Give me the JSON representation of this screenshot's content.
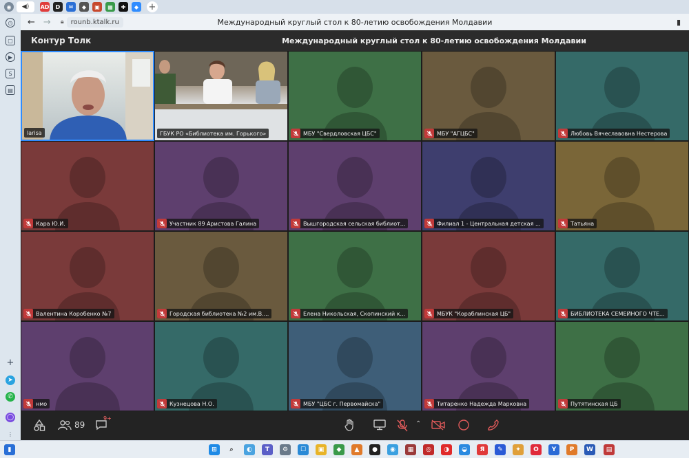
{
  "browser": {
    "url": "rounb.ktalk.ru",
    "page_title": "Международный круглый стол к 80-летию освобождения Молдавии",
    "tab_new_label": "+",
    "favicons": [
      {
        "name": "tab-favicon-ad",
        "glyph": "AD",
        "color": "#e03c3c"
      },
      {
        "name": "tab-favicon-d",
        "glyph": "D",
        "color": "#222222"
      },
      {
        "name": "tab-favicon-mail",
        "glyph": "✉",
        "color": "#2a6fd6"
      },
      {
        "name": "tab-favicon-cube",
        "glyph": "◆",
        "color": "#555555"
      },
      {
        "name": "tab-favicon-box",
        "glyph": "▣",
        "color": "#c7492e"
      },
      {
        "name": "tab-favicon-grid",
        "glyph": "▦",
        "color": "#3a9a4a"
      },
      {
        "name": "tab-favicon-plus",
        "glyph": "✚",
        "color": "#111111"
      },
      {
        "name": "tab-favicon-diamond",
        "glyph": "◆",
        "color": "#2f8cff"
      }
    ]
  },
  "app": {
    "brand": "Контур Толк",
    "meeting_title": "Международный круглый стол к 80-летию освобождения Молдавии"
  },
  "participants": [
    {
      "label": "larisa",
      "color": "#8fa0a6",
      "scene": "larisa",
      "muted": false,
      "active": true
    },
    {
      "label": "ГБУК РО «Библиотека им. Горького»",
      "color": "#a5a8a8",
      "scene": "gorky",
      "muted": false,
      "active": false
    },
    {
      "label": "МБУ \"Свердловская ЦБС\"",
      "color": "#3e7046",
      "muted": true
    },
    {
      "label": "МБУ \"АГЦБС\"",
      "color": "#6a5a3e",
      "muted": true
    },
    {
      "label": "Любовь Вячеславовна Нестерова",
      "color": "#356a68",
      "muted": true
    },
    {
      "label": "Кара Ю.И.",
      "color": "#7a3a3a",
      "muted": true
    },
    {
      "label": "Участник 89 Аристова Галина",
      "color": "#5e3f6e",
      "muted": true
    },
    {
      "label": "Вышгородская сельская библиот...",
      "color": "#5e3f6e",
      "muted": true
    },
    {
      "label": "Филиал 1 - Центральная детская ...",
      "color": "#3e3e6e",
      "muted": true
    },
    {
      "label": "Татьяна",
      "color": "#7a6638",
      "muted": true
    },
    {
      "label": "Валентина Коробенко №7",
      "color": "#7a3a3a",
      "muted": true
    },
    {
      "label": "Городская библиотека №2 им.В....",
      "color": "#6a5a3e",
      "muted": true
    },
    {
      "label": "Елена Никольская, Скопинский к...",
      "color": "#3e7046",
      "muted": true
    },
    {
      "label": "МБУК \"Кораблинская ЦБ\"",
      "color": "#7a3a3a",
      "muted": true
    },
    {
      "label": "БИБЛИОТЕКА СЕМЕЙНОГО ЧТЕ...",
      "color": "#356a68",
      "muted": true
    },
    {
      "label": "нмо",
      "color": "#5e3f6e",
      "muted": true
    },
    {
      "label": "Кузнецова Н.О.",
      "color": "#356a68",
      "muted": true
    },
    {
      "label": "МБУ \"ЦБС г. Первомайска\"",
      "color": "#3e5e78",
      "muted": true
    },
    {
      "label": "Титаренко Надежда Марковна",
      "color": "#5e3f6e",
      "muted": true
    },
    {
      "label": "Путятинская ЦБ",
      "color": "#3e7046",
      "muted": true
    }
  ],
  "controls": {
    "participants_count": "89",
    "chat_badge": "9+"
  },
  "colors": {
    "accent": "#2f8cff",
    "mute_red": "#c23a3a",
    "header_bg": "#2b2b2b"
  }
}
